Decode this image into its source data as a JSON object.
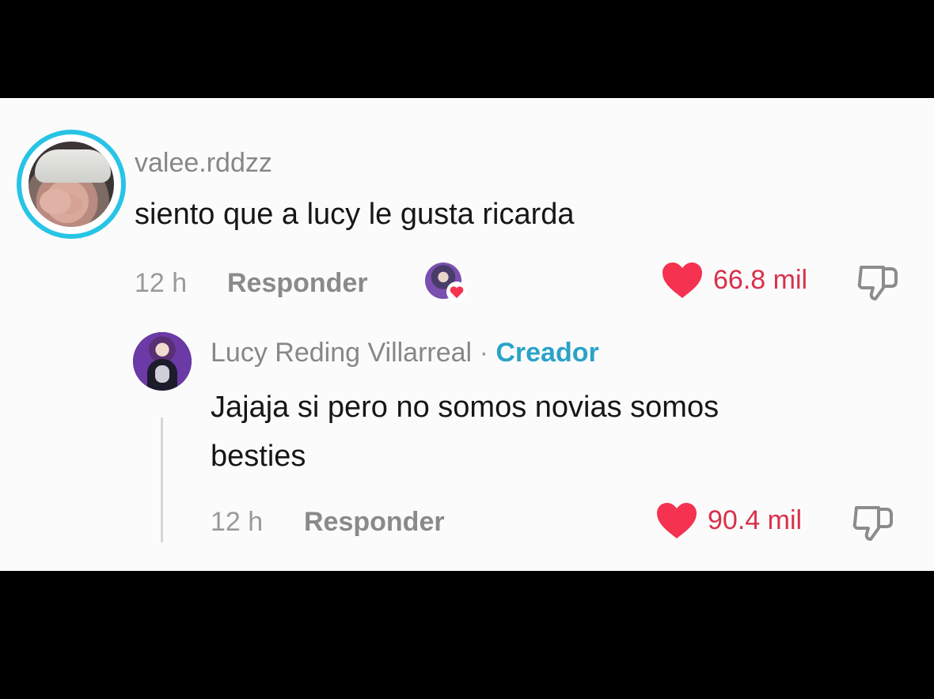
{
  "comment": {
    "username": "valee.rddzz",
    "text": "siento que a lucy le gusta ricarda",
    "time": "12 h",
    "reply_label": "Responder",
    "likes": "66.8 mil",
    "avatar_ring_color": "#27c4e6"
  },
  "reply": {
    "author": "Lucy Reding Villarreal",
    "separator": "·",
    "badge": "Creador",
    "text_line1": "Jajaja si pero no somos novias somos",
    "text_line2": "besties",
    "time": "12 h",
    "reply_label": "Responder",
    "likes": "90.4 mil"
  },
  "icons": {
    "like": "heart-icon",
    "dislike": "thumbs-down-icon",
    "creator_liked": "creator-heart-avatar"
  },
  "colors": {
    "like": "#f5324f",
    "like_count": "#d9304a",
    "creator_badge": "#2aa3c8"
  }
}
